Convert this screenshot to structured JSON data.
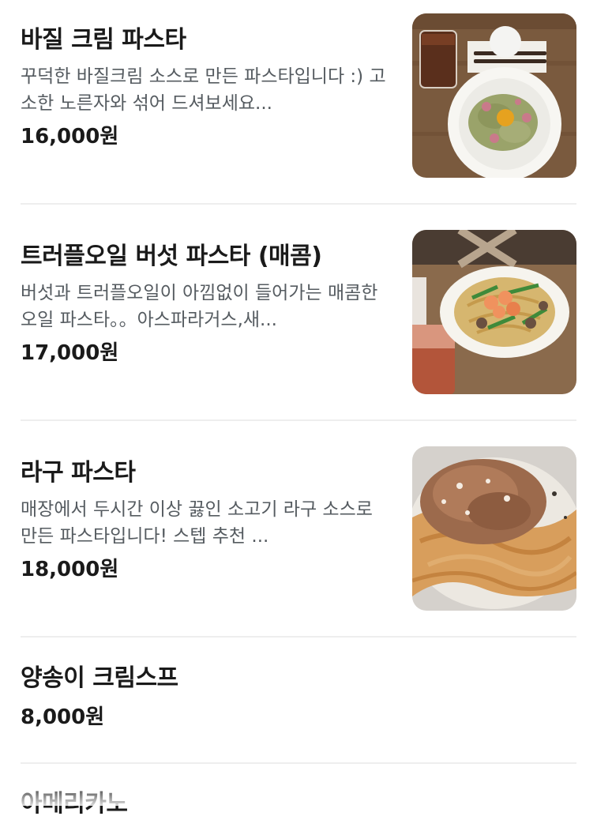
{
  "menu": {
    "items": [
      {
        "name": "바질 크림 파스타",
        "description": "꾸덕한 바질크림 소스로 만든 파스타입니다 :) 고소한 노른자와 섞어 드셔보세요...",
        "price": "16,000원",
        "photo_icon": "basil-cream-pasta-photo"
      },
      {
        "name": "트러플오일 버섯 파스타 (매콤)",
        "description": "버섯과 트러플오일이 아낌없이 들어가는 매콤한 오일 파스타。。아스파라거스,새...",
        "price": "17,000원",
        "photo_icon": "truffle-mushroom-pasta-photo"
      },
      {
        "name": "라구 파스타",
        "description": "매장에서 두시간 이상 끓인 소고기 라구 소스로 만든 파스타입니다! 스텝 추천 ...",
        "price": "18,000원",
        "photo_icon": "ragu-pasta-photo"
      },
      {
        "name": "양송이 크림스프",
        "price": "8,000원"
      },
      {
        "name": "아메리카노"
      }
    ]
  }
}
